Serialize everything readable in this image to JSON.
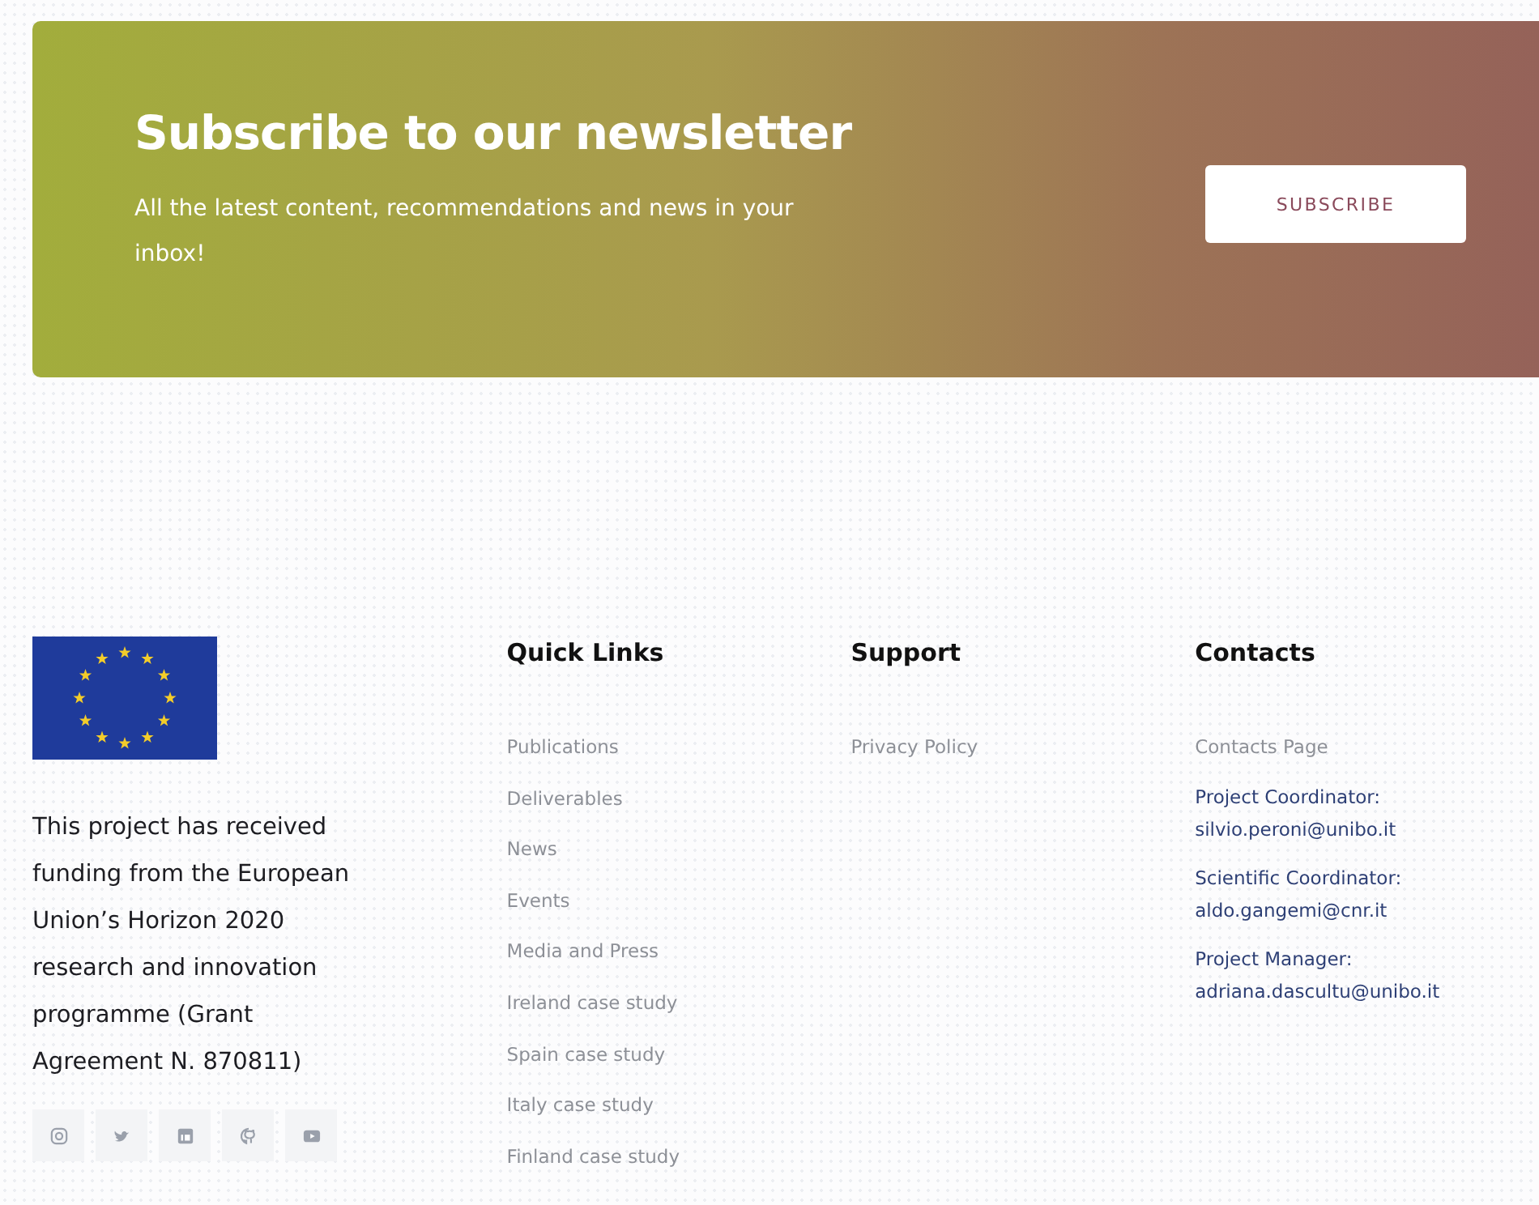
{
  "newsletter": {
    "title": "Subscribe to our newsletter",
    "text": "All the latest content, recommendations and news in your inbox!",
    "button": "SUBSCRIBE"
  },
  "footer": {
    "funding_text": "This project has received funding from the European Union’s Horizon 2020 research and innovation programme (Grant Agreement N. 870811)",
    "social": [
      {
        "kind": "instagram"
      },
      {
        "kind": "twitter"
      },
      {
        "kind": "linkedin"
      },
      {
        "kind": "github"
      },
      {
        "kind": "youtube"
      }
    ],
    "quick_links": {
      "title": "Quick Links",
      "items": [
        "Publications",
        "Deliverables",
        "News",
        "Events",
        "Media and Press",
        "Ireland case study",
        "Spain case study",
        "Italy case study",
        "Finland case study"
      ]
    },
    "support": {
      "title": "Support",
      "items": [
        "Privacy Policy"
      ]
    },
    "contacts": {
      "title": "Contacts",
      "page_link": "Contacts Page",
      "people": [
        {
          "role": "Project Coordinator:",
          "email": "silvio.peroni@unibo.it"
        },
        {
          "role": "Scientific Coordinator:",
          "email": "aldo.gangemi@cnr.it"
        },
        {
          "role": "Project Manager:",
          "email": "adriana.dascultu@unibo.it"
        }
      ]
    }
  }
}
